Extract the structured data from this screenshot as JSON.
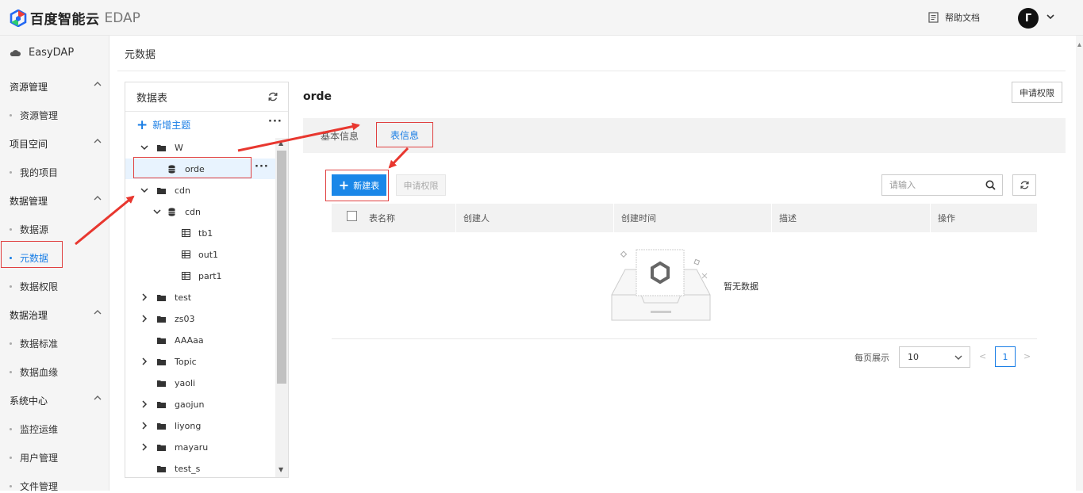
{
  "topbar": {
    "brand": "百度智能云",
    "product": "EDAP",
    "help_label": "帮助文档",
    "avatar_initial": "Γ"
  },
  "sidebar": {
    "brand": "EasyDAP",
    "groups": [
      {
        "label": "资源管理",
        "items": [
          "资源管理"
        ]
      },
      {
        "label": "项目空间",
        "items": [
          "我的项目"
        ]
      },
      {
        "label": "数据管理",
        "items": [
          "数据源",
          "元数据",
          "数据权限"
        ]
      },
      {
        "label": "数据治理",
        "items": [
          "数据标准",
          "数据血缘"
        ]
      },
      {
        "label": "系统中心",
        "items": [
          "监控运维",
          "用户管理",
          "文件管理"
        ]
      }
    ],
    "active_item": "元数据"
  },
  "breadcrumb": "元数据",
  "tree": {
    "title": "数据表",
    "add_topic": "新增主题",
    "more": "···",
    "nodes": [
      {
        "label": "W"
      },
      {
        "label": "orde",
        "selected": true
      },
      {
        "label": "cdn"
      },
      {
        "label": "cdn"
      },
      {
        "label": "tb1"
      },
      {
        "label": "out1"
      },
      {
        "label": "part1"
      },
      {
        "label": "test"
      },
      {
        "label": "zs03"
      },
      {
        "label": "AAAaa"
      },
      {
        "label": "Topic"
      },
      {
        "label": "yaoli"
      },
      {
        "label": "gaojun"
      },
      {
        "label": "liyong"
      },
      {
        "label": "mayaru"
      },
      {
        "label": "test_s"
      }
    ]
  },
  "detail": {
    "title": "orde",
    "apply_permission": "申请权限",
    "tabs": [
      "基本信息",
      "表信息"
    ],
    "active_tab": "表信息",
    "new_table": "新建表",
    "apply_permission_disabled": "申请权限",
    "search_placeholder": "请输入",
    "columns": [
      "表名称",
      "创建人",
      "创建时间",
      "描述",
      "操作"
    ],
    "empty_text": "暂无数据",
    "per_page_label": "每页展示",
    "per_page_value": "10",
    "current_page": "1",
    "prev": "<",
    "next": ">"
  },
  "colors": {
    "accent": "#1a7ee5",
    "primary_button": "#1a87e8",
    "annotation_red": "#e04040"
  }
}
